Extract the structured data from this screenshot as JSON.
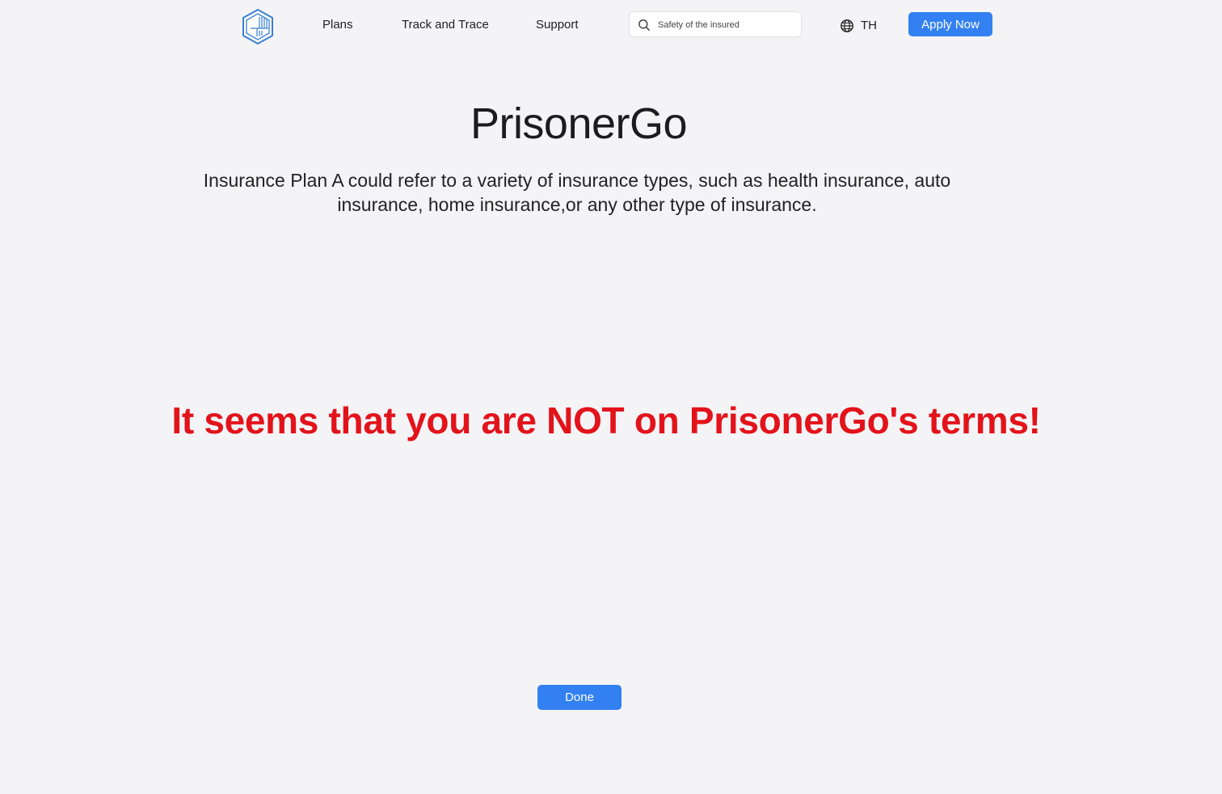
{
  "nav": {
    "links": [
      "Plans",
      "Track and Trace",
      "Support"
    ],
    "search_placeholder": "Safety of the insured",
    "language": "TH",
    "apply_label": "Apply Now"
  },
  "main": {
    "title": "PrisonerGo",
    "description": "Insurance Plan A could refer to a variety of insurance types, such as health insurance, auto insurance, home insurance,or any other type of insurance.",
    "warning_before": "It seems that you are ",
    "warning_emphasis": "NOT",
    "warning_after": " on PrisonerGo's terms!",
    "done_label": "Done"
  },
  "colors": {
    "accent": "#3380f2",
    "warning": "#e3131b",
    "logo": "#3a7fd0",
    "background": "#f4f4f6"
  },
  "icons": [
    "logo-icon",
    "search-icon",
    "globe-icon"
  ]
}
